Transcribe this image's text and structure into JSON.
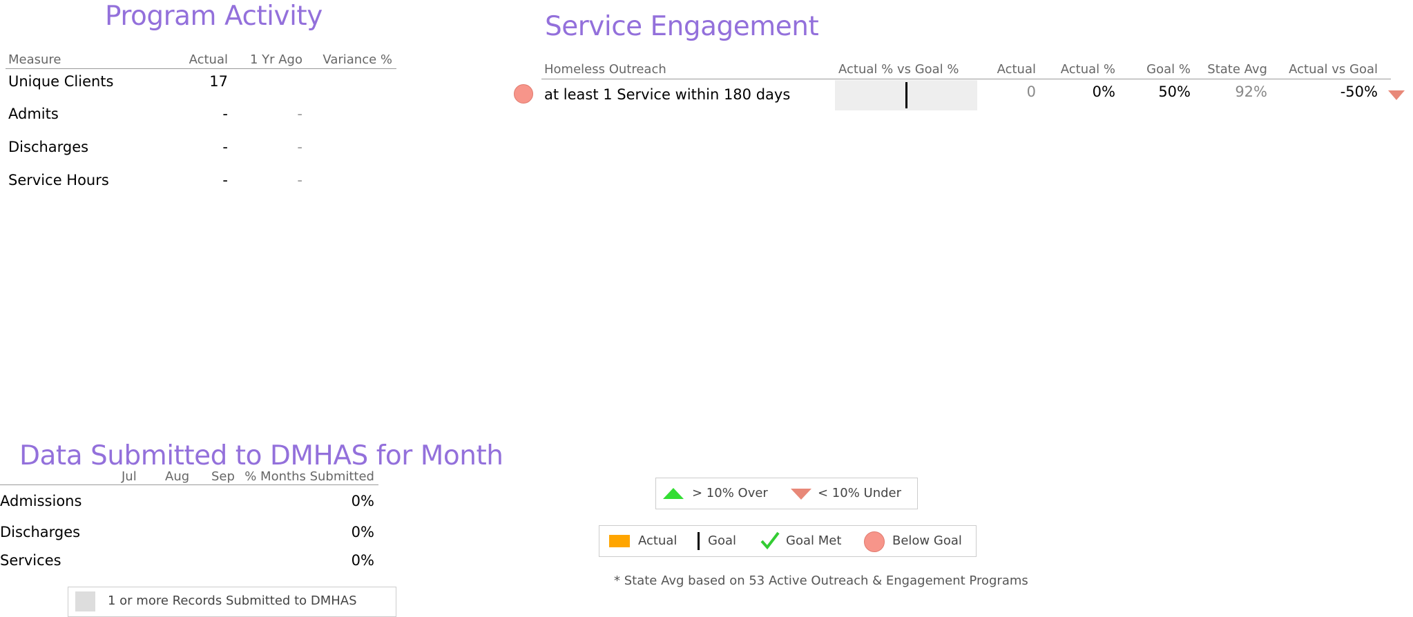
{
  "program_activity": {
    "title": "Program Activity",
    "headers": {
      "measure": "Measure",
      "actual": "Actual",
      "yr_ago": "1 Yr Ago",
      "variance": "Variance %"
    },
    "rows": [
      {
        "measure": "Unique Clients",
        "actual": "17",
        "yr_ago": "",
        "variance": ""
      },
      {
        "measure": "Admits",
        "actual": "-",
        "yr_ago": "-",
        "variance": ""
      },
      {
        "measure": "Discharges",
        "actual": "-",
        "yr_ago": "-",
        "variance": ""
      },
      {
        "measure": "Service Hours",
        "actual": "-",
        "yr_ago": "-",
        "variance": ""
      }
    ]
  },
  "service_engagement": {
    "title": "Service Engagement",
    "headers": {
      "program": "Homeless Outreach",
      "bar": "Actual % vs Goal %",
      "actual": "Actual",
      "actual_pct": "Actual %",
      "goal_pct": "Goal %",
      "state_avg": "State Avg",
      "actual_vs_goal": "Actual vs Goal"
    },
    "rows": [
      {
        "measure": "at least 1 Service within 180 days",
        "actual": "0",
        "actual_pct": "0%",
        "goal_pct": "50%",
        "state_avg": "92%",
        "actual_vs_goal": "-50%",
        "actual_fraction": 0.0,
        "goal_fraction": 0.5,
        "status": "below-goal",
        "trend": "under"
      }
    ]
  },
  "data_submitted": {
    "title": "Data Submitted to DMHAS for Month",
    "months": [
      "Jul",
      "Aug",
      "Sep"
    ],
    "pct_header": "% Months Submitted",
    "rows": [
      {
        "label": "Admissions",
        "pct": "0%"
      },
      {
        "label": "Discharges",
        "pct": "0%"
      },
      {
        "label": "Services",
        "pct": "0%"
      }
    ],
    "legend": "1 or more Records Submitted to DMHAS"
  },
  "legend": {
    "over": "> 10% Over",
    "under": "< 10% Under",
    "actual": "Actual",
    "goal": "Goal",
    "goal_met": "Goal Met",
    "below_goal": "Below Goal",
    "footnote": "* State Avg based on 53 Active Outreach & Engagement Programs"
  },
  "colors": {
    "title": "#9370DB",
    "actual_bar": "#FFA500",
    "below_goal": "#F7958A",
    "under_arrow": "#E88878",
    "over_arrow": "#33DD33",
    "goal_met": "#33CC33",
    "bar_bg": "#EEEEEE",
    "submitted_swatch": "#DDDDDD"
  }
}
